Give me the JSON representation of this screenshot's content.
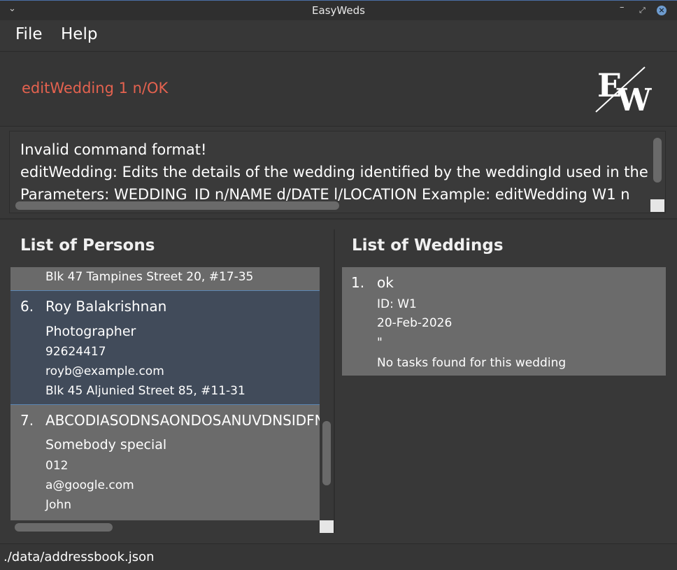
{
  "window": {
    "title": "EasyWeds"
  },
  "menu": {
    "file": "File",
    "help": "Help"
  },
  "command": {
    "text": "editWedding 1 n/OK",
    "color": "#e4624f"
  },
  "result": {
    "lines": [
      "Invalid command format!",
      "editWedding: Edits the details of the wedding identified by the weddingId used in the",
      "Parameters: WEDDING_ID n/NAME d/DATE l/LOCATION Example: editWedding W1 n"
    ]
  },
  "persons": {
    "title": "List of Persons",
    "partial_address": "Blk 47 Tampines Street 20, #17-35",
    "cards": [
      {
        "index": "6.",
        "name": "Roy Balakrishnan",
        "role": "Photographer",
        "phone": "92624417",
        "email": "royb@example.com",
        "address": "Blk 45 Aljunied Street 85, #11-31"
      },
      {
        "index": "7.",
        "name": "ABCODIASODNSAONDOSANUVDNSIDFNSDFNSDF",
        "role": "Somebody special",
        "phone": "012",
        "email": "a@google.com",
        "address": "John"
      }
    ]
  },
  "weddings": {
    "title": "List of Weddings",
    "items": [
      {
        "index": "1.",
        "name": "ok",
        "id": "ID: W1",
        "date": "20-Feb-2026",
        "location": "\"",
        "tasks": "No tasks found for this wedding"
      }
    ]
  },
  "status": {
    "path": "./data/addressbook.json"
  },
  "colors": {
    "background": "#383838",
    "selected_card": "#414b5a",
    "card": "#6b6b6b",
    "accent": "#5b87b3"
  }
}
